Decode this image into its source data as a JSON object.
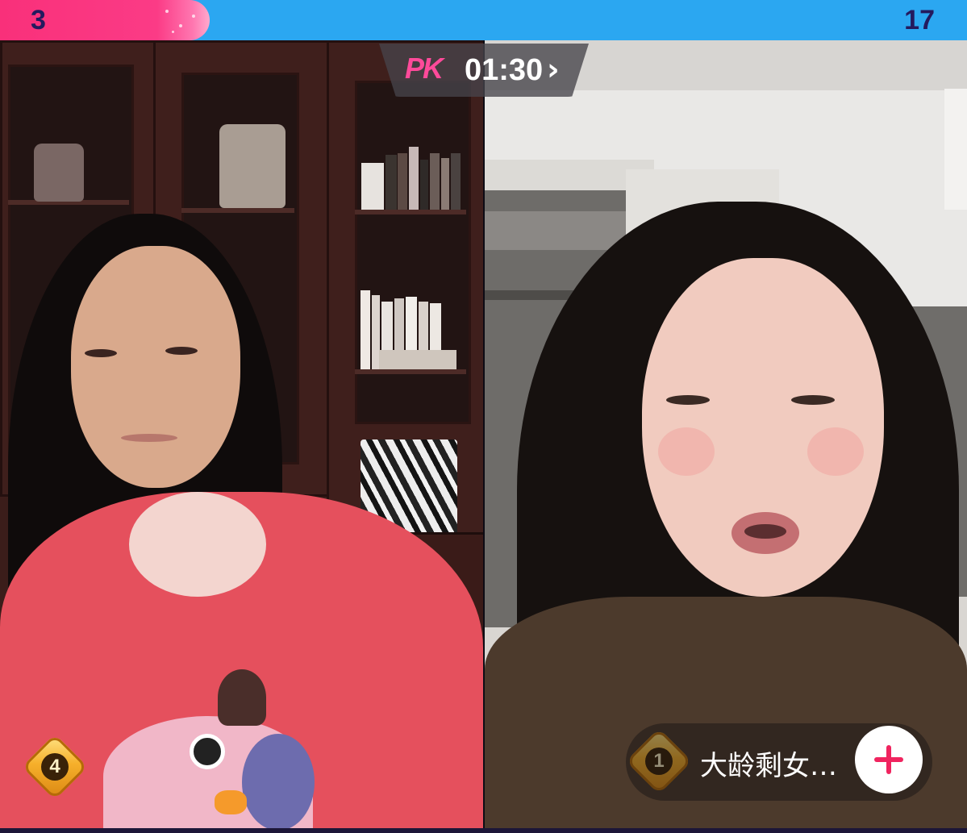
{
  "score": {
    "left": "3",
    "right": "17",
    "left_share": 0.15
  },
  "pk": {
    "logo": "PK",
    "timer": "01:30"
  },
  "left_host": {
    "rank": "4"
  },
  "right_host": {
    "rank": "1",
    "name": "大龄剩女…"
  },
  "icons": {
    "chevron": "chevron-right-icon",
    "follow": "plus-icon",
    "rank": "diamond-rank-icon"
  },
  "colors": {
    "left_team": "#f9307a",
    "right_team": "#2ba7f1",
    "score_text": "#241a5e",
    "follow_accent": "#f0245f"
  }
}
